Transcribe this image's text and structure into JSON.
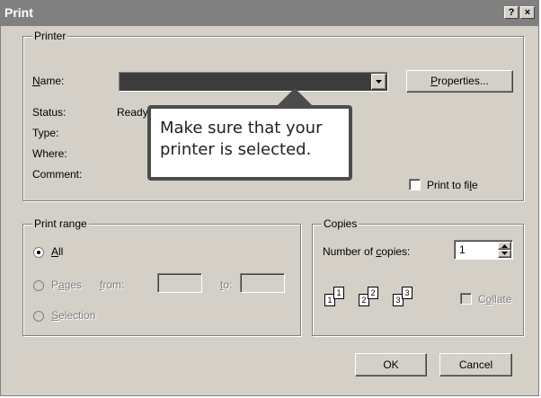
{
  "window": {
    "title": "Print",
    "help_button": "?",
    "close_button": "×"
  },
  "printer": {
    "legend": "Printer",
    "name_label_pre": "",
    "name_label_key": "N",
    "name_label_post": "ame:",
    "name_value": "",
    "properties_key": "P",
    "properties_post": "roperties...",
    "status_label": "Status:",
    "status_value": "Ready",
    "type_label": "Type:",
    "where_label": "Where:",
    "comment_label": "Comment:",
    "print_to_file_pre": "Print to fi",
    "print_to_file_key": "l",
    "print_to_file_post": "e",
    "print_to_file_checked": false
  },
  "tooltip": {
    "text": "Make sure that your\nprinter is selected."
  },
  "print_range": {
    "legend": "Print range",
    "all_key": "A",
    "all_post": "ll",
    "all_selected": true,
    "pages_pre": "P",
    "pages_key": "a",
    "pages_post": "ges",
    "from_key": "f",
    "from_post": "rom:",
    "to_key": "t",
    "to_post": "o:",
    "from_value": "",
    "to_value": "",
    "selection_key": "S",
    "selection_post": "election"
  },
  "copies": {
    "legend": "Copies",
    "number_label_pre": "Number of ",
    "number_label_key": "c",
    "number_label_post": "opies:",
    "number_value": "1",
    "collate_pre": "C",
    "collate_key": "o",
    "collate_post": "llate",
    "collate_checked": false,
    "collate_pages": [
      "1",
      "1",
      "2",
      "2",
      "3",
      "3"
    ]
  },
  "buttons": {
    "ok": "OK",
    "cancel": "Cancel"
  }
}
